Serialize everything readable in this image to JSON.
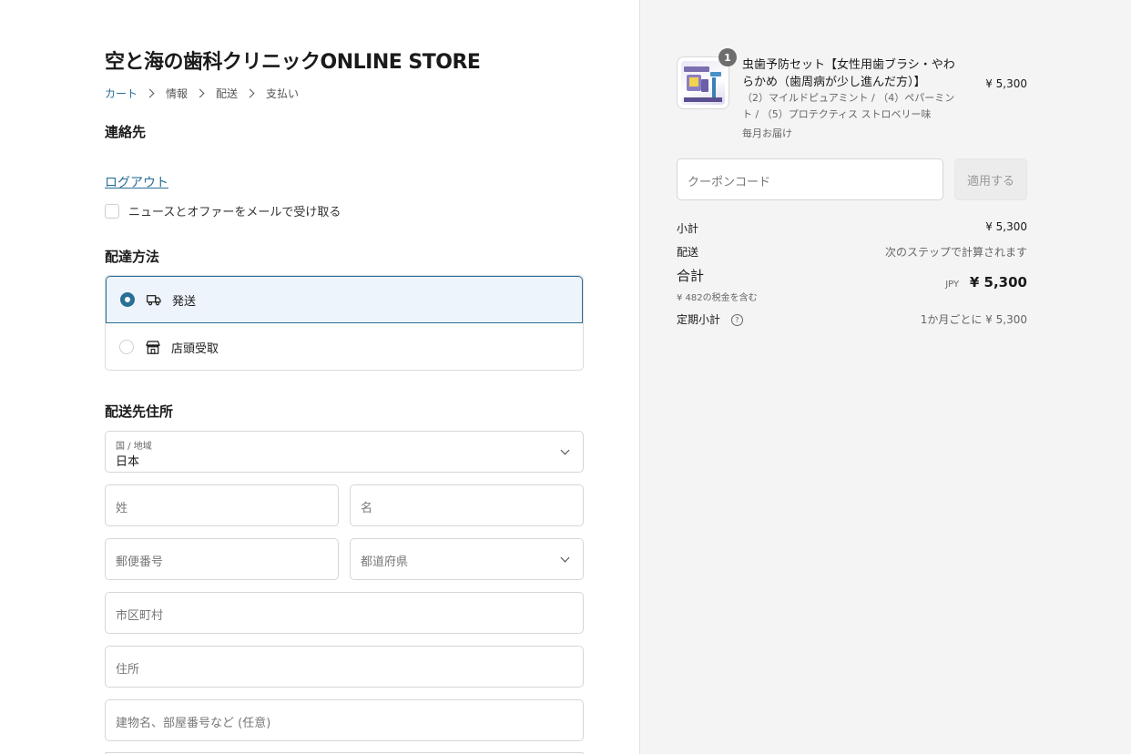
{
  "store": {
    "title": "空と海の歯科クリニックONLINE STORE"
  },
  "breadcrumb": [
    "カート",
    "情報",
    "配送",
    "支払い"
  ],
  "contact": {
    "heading": "連絡先",
    "logout_label": "ログアウト",
    "news_optin_label": "ニュースとオファーをメールで受け取る"
  },
  "delivery": {
    "heading": "配達方法",
    "options": [
      {
        "label": "発送",
        "icon": "truck-icon",
        "selected": true
      },
      {
        "label": "店頭受取",
        "icon": "store-icon",
        "selected": false
      }
    ]
  },
  "shipping_address": {
    "heading": "配送先住所",
    "country": {
      "label": "国 / 地域",
      "value": "日本"
    },
    "last_name_placeholder": "姓",
    "first_name_placeholder": "名",
    "postal_code_placeholder": "郵便番号",
    "prefecture_placeholder": "都道府県",
    "city_placeholder": "市区町村",
    "address_placeholder": "住所",
    "building_placeholder": "建物名、部屋番号など (任意)"
  },
  "cart": {
    "item": {
      "quantity_badge": "1",
      "title": "虫歯予防セット【女性用歯ブラシ・やわらかめ（歯周病が少し進んだ方）】",
      "variant": "（2）マイルドピュアミント / （4）ペパーミント / （5）プロテクティス ストロベリー味",
      "subscription": "毎月お届け",
      "price": "¥ 5,300"
    },
    "coupon_placeholder": "クーポンコード",
    "apply_label": "適用する"
  },
  "summary": {
    "subtotal_label": "小計",
    "subtotal_value": "¥ 5,300",
    "shipping_label": "配送",
    "shipping_value": "次のステップで計算されます",
    "total_label": "合計",
    "tax_note": "¥ 482の税金を含む",
    "currency": "JPY",
    "total_value": "¥ 5,300",
    "recurring_label": "定期小計",
    "recurring_value": "1か月ごとに ¥ 5,300"
  },
  "colors": {
    "accent": "#2a6f97",
    "sidebar_bg": "#f4f4f4",
    "selected_bg": "#eef4fb"
  }
}
